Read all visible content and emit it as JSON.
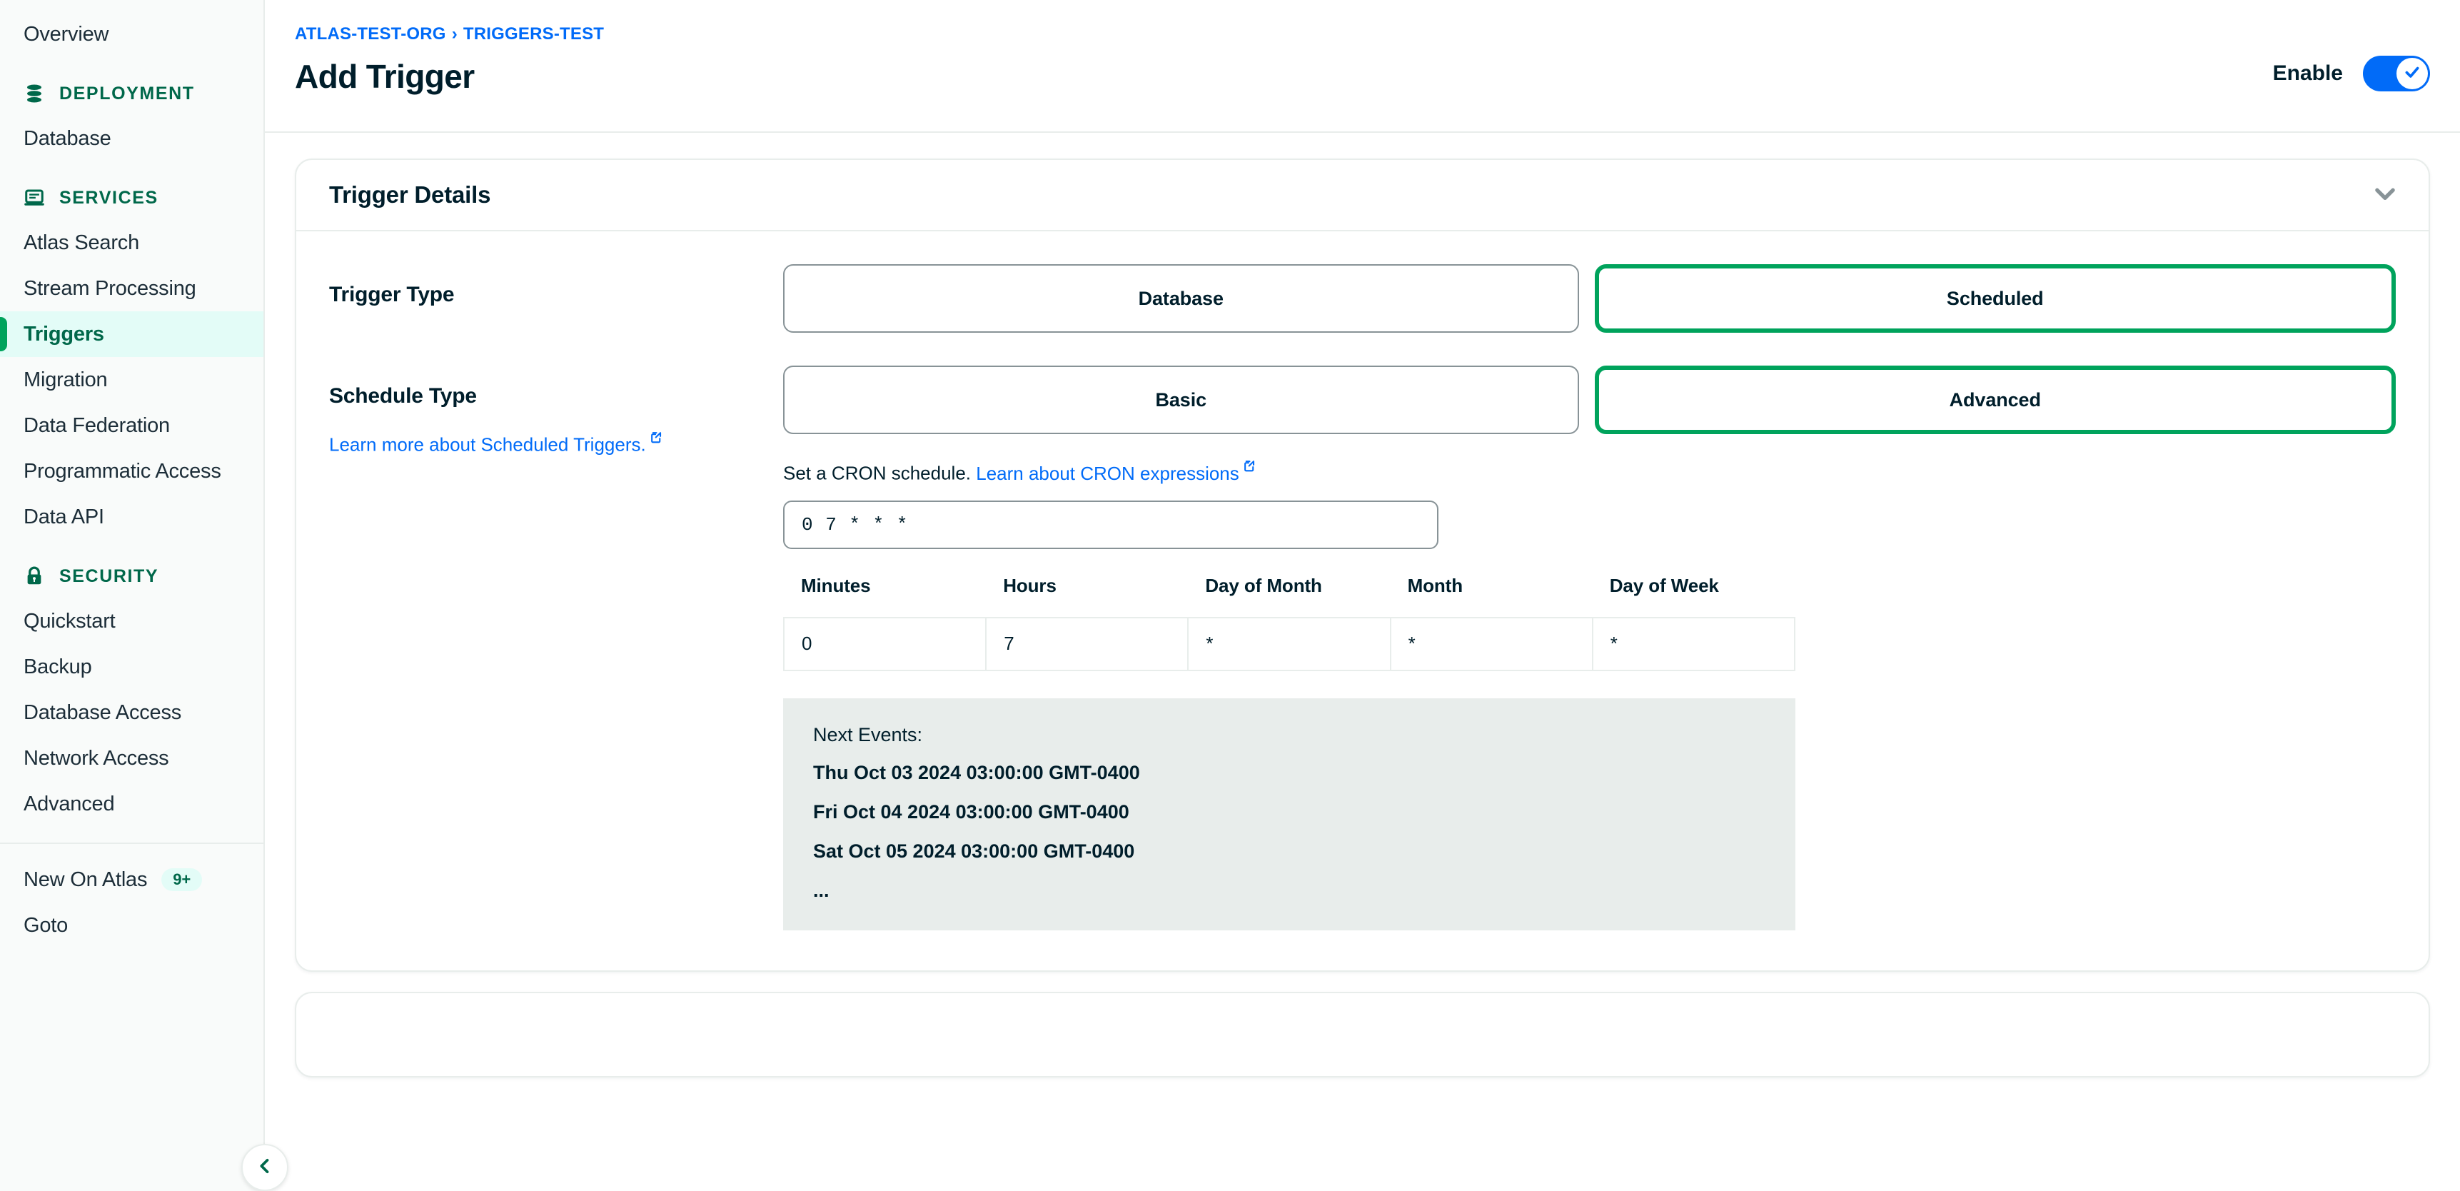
{
  "sidebar": {
    "overview_label": "Overview",
    "sections": {
      "deployment": "DEPLOYMENT",
      "services": "SERVICES",
      "security": "SECURITY"
    },
    "deployment_items": [
      {
        "label": "Database"
      }
    ],
    "services_items": [
      {
        "label": "Atlas Search"
      },
      {
        "label": "Stream Processing"
      },
      {
        "label": "Triggers"
      },
      {
        "label": "Migration"
      },
      {
        "label": "Data Federation"
      },
      {
        "label": "Programmatic Access"
      },
      {
        "label": "Data API"
      }
    ],
    "security_items": [
      {
        "label": "Quickstart"
      },
      {
        "label": "Backup"
      },
      {
        "label": "Database Access"
      },
      {
        "label": "Network Access"
      },
      {
        "label": "Advanced"
      }
    ],
    "footer_items": [
      {
        "label": "New On Atlas",
        "badge": "9+"
      },
      {
        "label": "Goto",
        "badge": ""
      }
    ],
    "active_item": "Triggers",
    "collapse_icon": "chevron-left-icon"
  },
  "header": {
    "breadcrumb_org": "ATLAS-TEST-ORG",
    "breadcrumb_separator": "›",
    "breadcrumb_project": "TRIGGERS-TEST",
    "title": "Add Trigger",
    "enable_label": "Enable",
    "enable_state": "on"
  },
  "trigger_details": {
    "card_title": "Trigger Details",
    "collapse_icon": "chevron-down-icon",
    "trigger_type": {
      "label": "Trigger Type",
      "options": [
        {
          "label": "Database",
          "selected": false
        },
        {
          "label": "Scheduled",
          "selected": true
        }
      ]
    },
    "schedule_type": {
      "label": "Schedule Type",
      "learn_more_link": "Learn more about Scheduled Triggers.",
      "options": [
        {
          "label": "Basic",
          "selected": false
        },
        {
          "label": "Advanced",
          "selected": true
        }
      ],
      "cron_help_prefix": "Set a CRON schedule.",
      "cron_help_link": "Learn about CRON expressions",
      "cron_value": "0 7 * * *",
      "cron_table": {
        "headers": [
          "Minutes",
          "Hours",
          "Day of Month",
          "Month",
          "Day of Week"
        ],
        "row": [
          "0",
          "7",
          "*",
          "*",
          "*"
        ]
      },
      "next_events": {
        "title": "Next Events:",
        "items": [
          "Thu Oct 03 2024 03:00:00 GMT-0400",
          "Fri Oct 04 2024 03:00:00 GMT-0400",
          "Sat Oct 05 2024 03:00:00 GMT-0400"
        ],
        "ellipsis": "..."
      }
    }
  },
  "colors": {
    "brand_green": "#00684A",
    "accent_green": "#00A35C",
    "link_blue": "#016BF8",
    "toggle_blue": "#016BF8",
    "text_dark": "#001E2B",
    "sidebar_bg": "#F9FBFA",
    "active_bg": "#E3FCF7",
    "border": "#E8EDEB",
    "panel_gray": "#E8EDEB"
  }
}
